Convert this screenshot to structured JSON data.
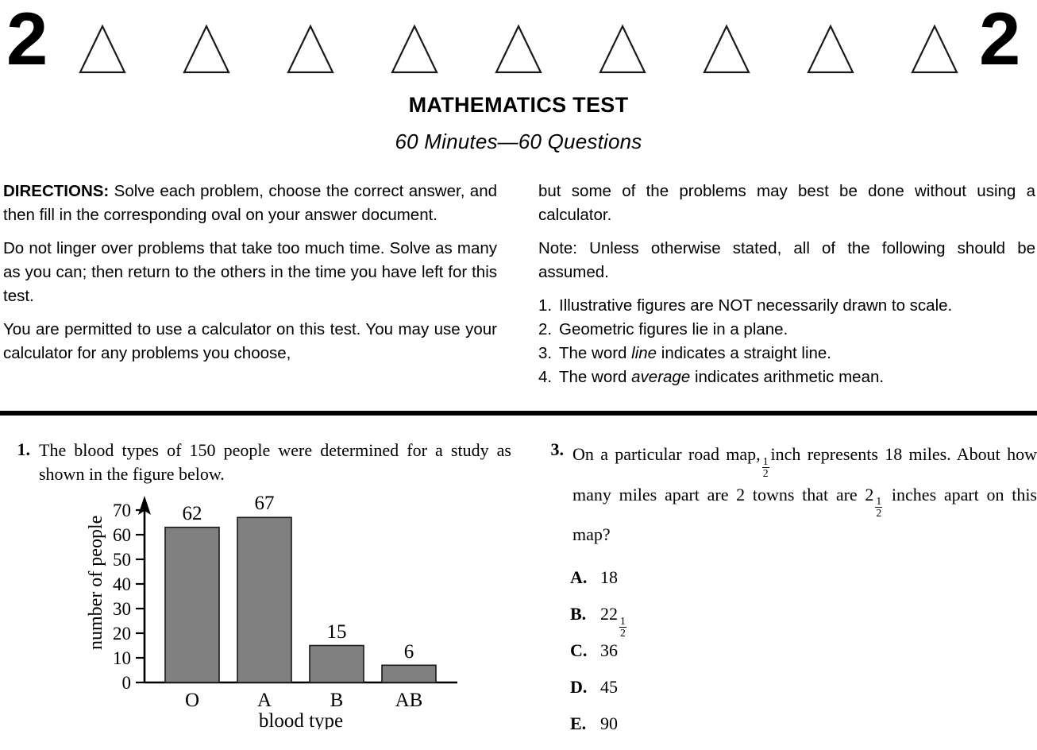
{
  "header": {
    "page_number_left": "2",
    "page_number_right": "2",
    "triangle_count": 9,
    "triangle_icon": "triangle-outline-icon"
  },
  "titles": {
    "test_title": "MATHEMATICS TEST",
    "test_subtitle": "60 Minutes—60 Questions"
  },
  "directions": {
    "label": "DIRECTIONS:",
    "left_column": [
      "Solve each problem, choose the correct answer, and then fill in the corresponding oval on your answer document.",
      "Do not linger over problems that take too much time. Solve as many as you can; then return to the others in the time you have left for this test.",
      "You are permitted to use a calculator on this test. You may use your calculator for any problems you choose,"
    ],
    "right_column": [
      "but some of the problems may best be done without using a calculator.",
      "Note: Unless otherwise stated, all of the following should be assumed."
    ],
    "notes": [
      {
        "number": "1.",
        "pre": "Illustrative figures are NOT necessarily drawn to scale.",
        "italic": "",
        "post": ""
      },
      {
        "number": "2.",
        "pre": "Geometric figures lie in a plane.",
        "italic": "",
        "post": ""
      },
      {
        "number": "3.",
        "pre": "The word ",
        "italic": "line",
        "post": " indicates a straight line."
      },
      {
        "number": "4.",
        "pre": "The word ",
        "italic": "average",
        "post": " indicates arithmetic mean."
      }
    ]
  },
  "question_1": {
    "number": "1.",
    "text": "The blood types of 150 people were determined for a study as shown in the figure below."
  },
  "question_3": {
    "number": "3.",
    "text_part_1": "On a particular road map,",
    "fraction_1": {
      "numerator": "1",
      "denominator": "2"
    },
    "text_part_2": "inch represents 18 miles. About how many miles apart are 2 towns that are",
    "mixed_whole": "2",
    "fraction_2": {
      "numerator": "1",
      "denominator": "2"
    },
    "text_part_3": "inches apart on this map?",
    "choices": [
      {
        "letter": "A.",
        "value": "18",
        "whole": "18",
        "frac_num": "",
        "frac_den": ""
      },
      {
        "letter": "B.",
        "value": "22 1/2",
        "whole": "22",
        "frac_num": "1",
        "frac_den": "2"
      },
      {
        "letter": "C.",
        "value": "36",
        "whole": "36",
        "frac_num": "",
        "frac_den": ""
      },
      {
        "letter": "D.",
        "value": "45",
        "whole": "45",
        "frac_num": "",
        "frac_den": ""
      },
      {
        "letter": "E.",
        "value": "90",
        "whole": "90",
        "frac_num": "",
        "frac_den": ""
      }
    ]
  },
  "chart_data": {
    "type": "bar",
    "title": "",
    "xlabel": "blood type",
    "ylabel": "number of people",
    "categories": [
      "O",
      "A",
      "B",
      "AB"
    ],
    "values": [
      62,
      67,
      15,
      6
    ],
    "bar_pixel_values": [
      63,
      67,
      15,
      7
    ],
    "data_labels": [
      "62",
      "67",
      "15",
      "6"
    ],
    "ytick_labels": [
      "0",
      "10",
      "20",
      "30",
      "40",
      "50",
      "60",
      "70"
    ],
    "yticks": [
      0,
      10,
      20,
      30,
      40,
      50,
      60,
      70
    ],
    "ylim": [
      0,
      74
    ],
    "grid": false,
    "legend": false,
    "bar_color": "#808080",
    "bar_edge_color": "#1a1a1a",
    "axis_color": "#000000",
    "total": 150
  }
}
